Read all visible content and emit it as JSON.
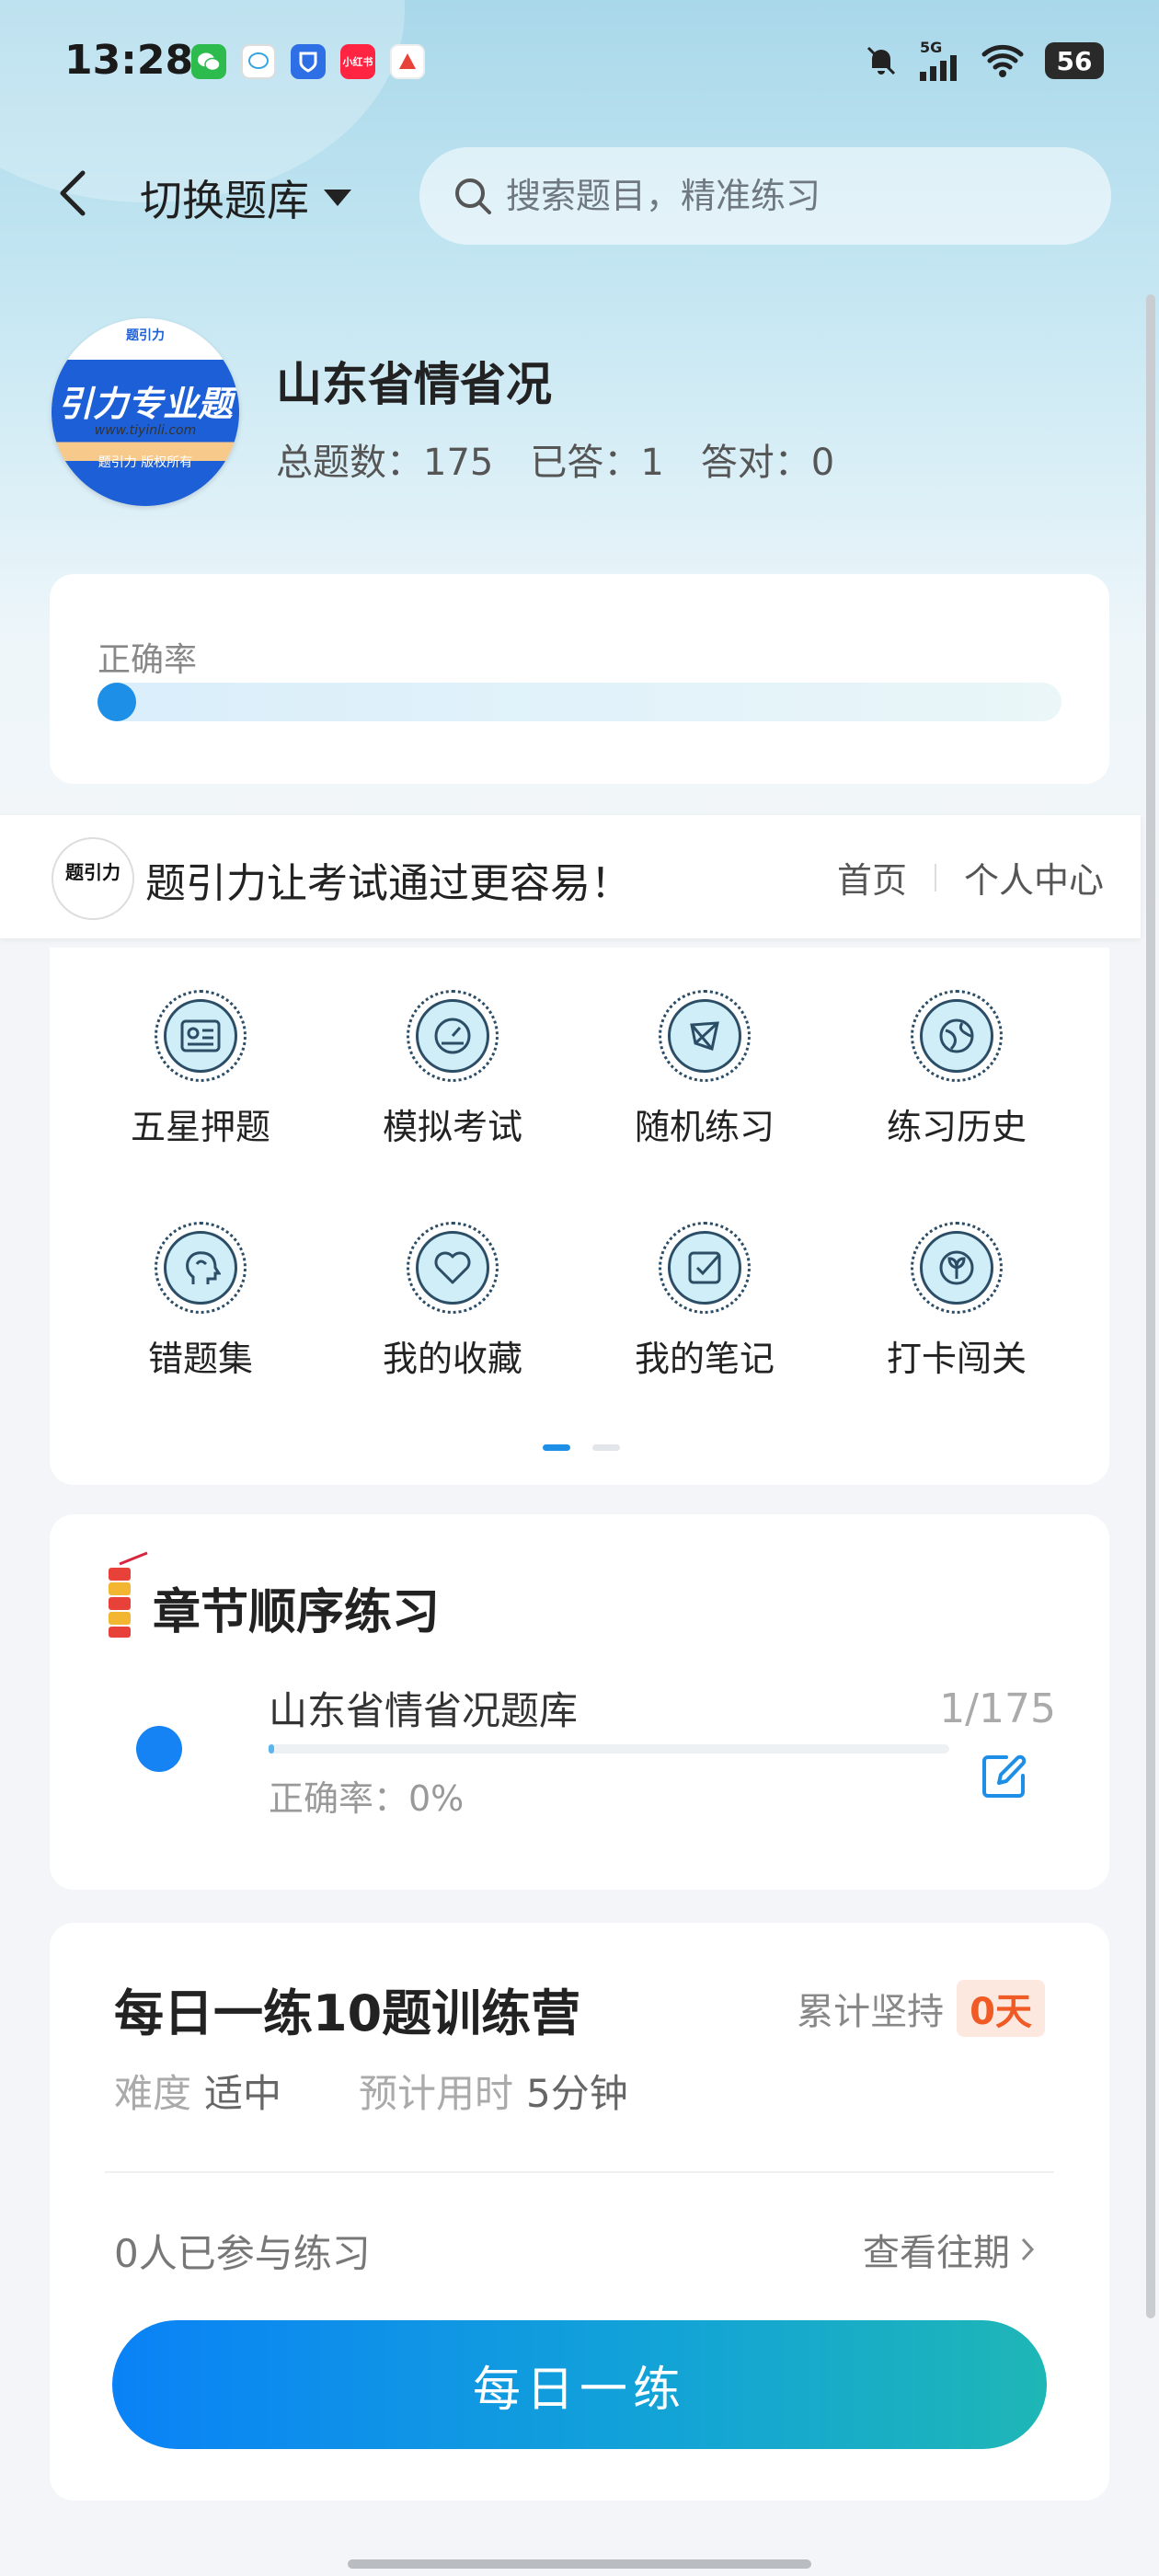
{
  "status_bar": {
    "time": "13:28",
    "apps": [
      {
        "name": "wechat-icon",
        "color": "#2dbb4e",
        "label": ""
      },
      {
        "name": "messages-icon",
        "color": "#ffffff",
        "label": ""
      },
      {
        "name": "shield-app-icon",
        "color": "#2f6fe5",
        "label": ""
      },
      {
        "name": "xiaohongshu-icon",
        "color": "#ff2442",
        "label": "小红书"
      },
      {
        "name": "arrow-app-icon",
        "color": "#e8413a",
        "label": ""
      }
    ],
    "network": "5G",
    "battery": "56"
  },
  "header": {
    "switch_label": "切换题库",
    "search_placeholder": "搜索题目，精准练习"
  },
  "bank": {
    "logo_top": "题引力",
    "logo_main": "引力专业题",
    "logo_url": "www.tiyinli.com",
    "logo_bottom": "题引力 版权所有",
    "title": "山东省情省况",
    "total_label": "总题数：175",
    "answered_label": "已答：1",
    "correct_label": "答对：0"
  },
  "accuracy": {
    "label": "正确率",
    "value_fraction": 0
  },
  "nav": {
    "logo_text": "题引力",
    "slogan": "题引力让考试通过更容易！",
    "home": "首页",
    "profile": "个人中心"
  },
  "grid": {
    "items": [
      {
        "label": "五星押题",
        "icon": "id-card-icon"
      },
      {
        "label": "模拟考试",
        "icon": "gauge-icon"
      },
      {
        "label": "随机练习",
        "icon": "network-icon"
      },
      {
        "label": "练习历史",
        "icon": "globe-icon"
      },
      {
        "label": "错题集",
        "icon": "head-icon"
      },
      {
        "label": "我的收藏",
        "icon": "heart-icon"
      },
      {
        "label": "我的笔记",
        "icon": "checkbox-icon"
      },
      {
        "label": "打卡闯关",
        "icon": "sprout-icon"
      }
    ]
  },
  "chapter": {
    "title": "章节顺序练习",
    "name": "山东省情省况题库",
    "accuracy": "正确率：0%",
    "count": "1/175"
  },
  "daily": {
    "title": "每日一练10题训练营",
    "persist_label": "累计坚持",
    "persist_value": "0天",
    "difficulty_key": "难度",
    "difficulty_value": "适中",
    "time_key": "预计用时",
    "time_value": "5分钟",
    "joined": "0人已参与练习",
    "history": "查看往期",
    "button": "每日一练"
  },
  "colors": {
    "accent": "#1e8fe6",
    "orange": "#f05a24"
  }
}
